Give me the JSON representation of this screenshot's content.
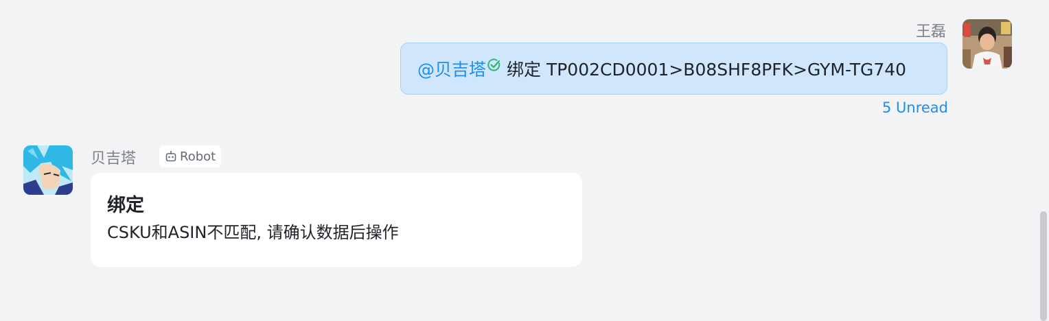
{
  "outgoing_message": {
    "sender": "王磊",
    "mention": "@贝吉塔",
    "text": "绑定 TP002CD0001>B08SHF8PFK>GYM-TG740",
    "unread": "5 Unread"
  },
  "incoming_message": {
    "sender": "贝吉塔",
    "badge": "Robot",
    "card_title": "绑定",
    "card_body": "CSKU和ASIN不匹配, 请确认数据后操作"
  },
  "icons": {
    "mention_status": "check-circle-icon",
    "badge": "robot-icon"
  },
  "colors": {
    "background": "#f2f3f5",
    "outgoing_bubble": "#cfe6fd",
    "link": "#1d8ef0",
    "check": "#2fb66e"
  }
}
